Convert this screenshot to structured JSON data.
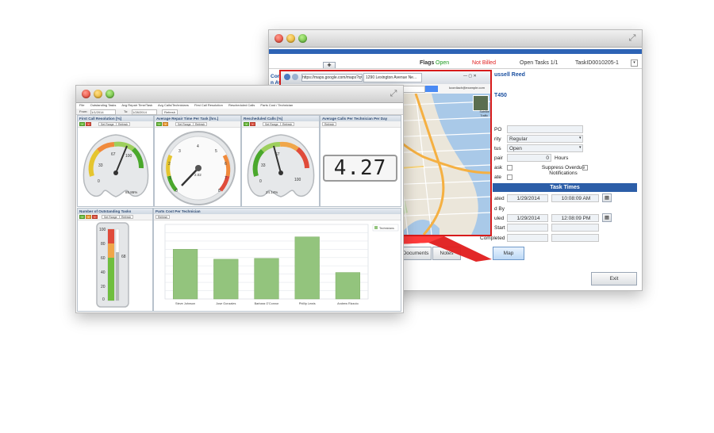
{
  "back_window": {
    "flags_label": "Flags",
    "status_open": "Open",
    "status_billing": "Not Billed",
    "open_tasks": "Open Tasks 1/1",
    "task_id": "TaskID0010205-1",
    "customer_name": "ussell Reed",
    "left_fragment_1": "Com",
    "left_fragment_2": "n Av",
    "model": "T450",
    "po_label": "PO",
    "priority_label": "rity",
    "priority_value": "Regular",
    "status_label": "tus",
    "status_value": "Open",
    "repair_label": "pair",
    "repair_hours": "0",
    "hours_label": "Hours",
    "task_label": "ask",
    "suppress_label": "Suppress Overdue Notifications",
    "rate_label": "ate",
    "section_title": "Task Times",
    "created_label": "ated",
    "created_date": "1/29/2014",
    "created_time": "10:08:09 AM",
    "by_label": "d By",
    "scheduled_label": "uled",
    "scheduled_date": "1/29/2014",
    "scheduled_time": "12:08:09 PM",
    "start_label": "Start",
    "completed_label": "Completed",
    "btn_documents": "Documents",
    "btn_notes": "Notes",
    "btn_map": "Map",
    "btn_exit": "Exit",
    "btn_add": "✚"
  },
  "map_browser": {
    "url": "https://maps.google.com/maps?q=...",
    "tab1": "1290 Lexington Avenue Ne...",
    "search_hint": "Search",
    "satellite": "Satellite",
    "traffic": "Traffic",
    "account": "kcordiach@example.com"
  },
  "front_window": {
    "menu": [
      "File",
      "Outstanding Tasks",
      "Avg Repair Time/Task",
      "Avg Calls/Technicians",
      "First Call Resolution",
      "Rescheduled Calls",
      "Parts Cost / Technician"
    ],
    "from_label": "From:",
    "from_value": "1/1/2014",
    "to_label": "To:",
    "to_value": "1/28/2014",
    "refresh": "Refresh",
    "panels": {
      "first_call": {
        "title": "First Call Resolution [%]",
        "buttons": [
          "",
          "",
          "Set Range",
          "Refresh"
        ],
        "ticks": [
          "0",
          "33",
          "67",
          "100"
        ],
        "readout": "85.86%"
      },
      "avg_repair": {
        "title": "Average Repair Time Per Task [hrs.]",
        "buttons": [
          "",
          "",
          "Set Range",
          "Refresh"
        ],
        "ticks": [
          "0",
          "1",
          "2",
          "3",
          "4",
          "5",
          "6",
          "7",
          "8"
        ],
        "readout": "2.02"
      },
      "rescheduled": {
        "title": "Rescheduled Calls [%]",
        "buttons": [
          "",
          "",
          "Set Range",
          "Refresh"
        ],
        "ticks": [
          "0",
          "33",
          "67",
          "100"
        ],
        "readout": "24.14%"
      },
      "avg_calls": {
        "title": "Average Calls Per Technician Per Day",
        "buttons": [
          "Refresh"
        ],
        "value": "4.27"
      },
      "outstanding": {
        "title": "Number of Outstanding Tasks",
        "buttons": [
          "",
          "",
          "",
          "Set Range",
          "Refresh"
        ],
        "ticks": [
          "0",
          "20",
          "40",
          "60",
          "80",
          "100"
        ],
        "value_label": "68"
      },
      "parts_cost": {
        "title": "Parts Cost Per Technician",
        "buttons": [
          "Refresh"
        ]
      }
    }
  },
  "chart_data": {
    "type": "bar",
    "title": "Parts Cost Per Technician",
    "categories": [
      "Steve Johnson",
      "Jose Gonzales",
      "Barbara O'Connor",
      "Phillip Lewis",
      "Andrew Rizzuto"
    ],
    "series": [
      {
        "name": "Technicians",
        "values": [
          60,
          48,
          49,
          75,
          32
        ]
      }
    ],
    "ylim": [
      0,
      90
    ],
    "legend": "top-right",
    "grid": true,
    "bar_color": "#93c47d"
  },
  "colors": {
    "accent_blue": "#2c5ea8",
    "alert_red": "#d81b1b",
    "open_green": "#1f9b1f",
    "not_billed_red": "#e02020"
  }
}
